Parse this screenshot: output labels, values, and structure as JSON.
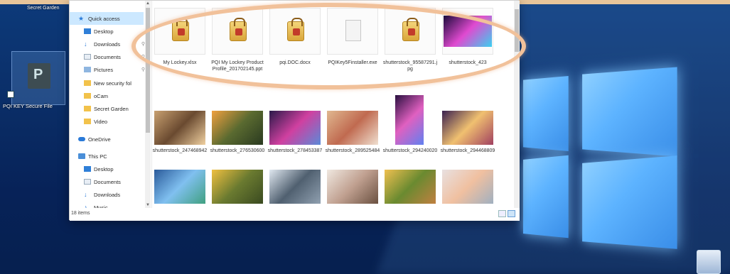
{
  "desktop": {
    "top_folder_label": "Secret Garden",
    "shortcut_label": "PQI KEY Secure File"
  },
  "explorer": {
    "nav": [
      {
        "label": "Quick access",
        "icon": "star-icon",
        "selected": true
      },
      {
        "label": "Desktop",
        "icon": "desktop-icon"
      },
      {
        "label": "Downloads",
        "icon": "download-icon",
        "pinned": true
      },
      {
        "label": "Documents",
        "icon": "documents-icon",
        "pinned": true
      },
      {
        "label": "Pictures",
        "icon": "pictures-icon",
        "pinned": true
      },
      {
        "label": "New security fol",
        "icon": "folder-icon"
      },
      {
        "label": "oCam",
        "icon": "folder-icon"
      },
      {
        "label": "Secret Garden",
        "icon": "folder-icon"
      },
      {
        "label": "Video",
        "icon": "folder-icon"
      },
      {
        "label": "OneDrive",
        "icon": "cloud-icon"
      },
      {
        "label": "This PC",
        "icon": "pc-icon"
      },
      {
        "label": "Desktop",
        "icon": "desktop-icon"
      },
      {
        "label": "Documents",
        "icon": "documents-icon"
      },
      {
        "label": "Downloads",
        "icon": "download-icon"
      },
      {
        "label": "Music",
        "icon": "music-icon"
      }
    ],
    "status": "18 items",
    "files_row1": [
      {
        "name": "My Lockey.xlsx",
        "kind": "locked"
      },
      {
        "name": "PQI My Lockey Product Profile_201702145.ppt",
        "kind": "locked"
      },
      {
        "name": "pqi.DOC.docx",
        "kind": "locked"
      },
      {
        "name": "PQIKey5Finstaller.exe",
        "kind": "blank"
      },
      {
        "name": "shutterstock_95587291.jpg",
        "kind": "locked"
      },
      {
        "name": "shutterstock_423",
        "kind": "photo",
        "colors": [
          "#1a0a3a",
          "#e04ad0",
          "#3ad0f0"
        ]
      }
    ],
    "files_row2": [
      {
        "name": "shutterstock_247468942",
        "colors": [
          "#c8a070",
          "#6a4a30",
          "#f0d0a0"
        ]
      },
      {
        "name": "shutterstock_276530600",
        "colors": [
          "#f0a040",
          "#5a6a30",
          "#2a3a20"
        ]
      },
      {
        "name": "shutterstock_278453387",
        "colors": [
          "#2a1a4a",
          "#d040a0",
          "#5a8ad8"
        ]
      },
      {
        "name": "shutterstock_289525484",
        "colors": [
          "#e0b890",
          "#c06a50",
          "#f0e0d0"
        ]
      },
      {
        "name": "shutterstock_294240020",
        "colors": [
          "#2a1040",
          "#e060c0",
          "#6080f0"
        ]
      },
      {
        "name": "shutterstock_294468809",
        "colors": [
          "#3a2050",
          "#f0c070",
          "#a04060"
        ]
      }
    ],
    "files_row3": [
      {
        "name": "",
        "colors": [
          "#2a5a9a",
          "#80c0f0",
          "#40a080"
        ]
      },
      {
        "name": "",
        "colors": [
          "#f0c040",
          "#6a7a30",
          "#3a4a20"
        ]
      },
      {
        "name": "",
        "colors": [
          "#e0e8f0",
          "#506070",
          "#90a0b0"
        ]
      },
      {
        "name": "",
        "colors": [
          "#f0e8e0",
          "#c0a090",
          "#6a5040"
        ]
      },
      {
        "name": "",
        "colors": [
          "#f0c050",
          "#6a8a30",
          "#c08040"
        ]
      },
      {
        "name": "",
        "colors": [
          "#e8e0e0",
          "#f0c0a0",
          "#a0b0c0"
        ]
      }
    ]
  }
}
